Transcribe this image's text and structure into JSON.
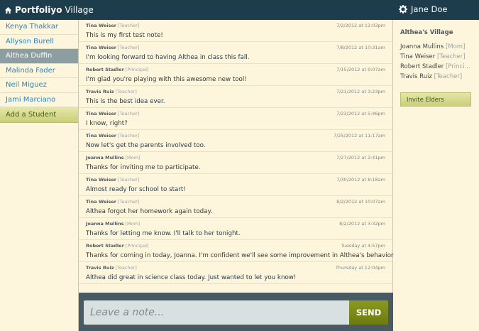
{
  "header": {
    "brand_bold": "Portfoliyo",
    "brand_rest": "Village",
    "user_name": "Jane Doe"
  },
  "students": [
    {
      "name": "Kenya Thakkar",
      "active": false
    },
    {
      "name": "Allyson Burell",
      "active": false
    },
    {
      "name": "Althea Duffin",
      "active": true
    },
    {
      "name": "Malinda Fader",
      "active": false
    },
    {
      "name": "Neil Miguez",
      "active": false
    },
    {
      "name": "Jami Marciano",
      "active": false
    }
  ],
  "add_student_label": "Add a Student",
  "notes": [
    {
      "author": "Tina Weiser",
      "role": "[Teacher]",
      "time": "7/2/2012 at 12:03pm",
      "text": "This is my first test note!"
    },
    {
      "author": "Tina Weiser",
      "role": "[Teacher]",
      "time": "7/8/2012 at 10:31am",
      "text": "I'm looking forward to having Althea in class this fall."
    },
    {
      "author": "Robert Stadler",
      "role": "[Principal]",
      "time": "7/15/2012 at 9:07am",
      "text": "I'm glad you're playing with this awesome new tool!"
    },
    {
      "author": "Travis Ruiz",
      "role": "[Teacher]",
      "time": "7/21/2012 at 3:23pm",
      "text": "This is the best idea ever."
    },
    {
      "author": "Tina Weiser",
      "role": "[Teacher]",
      "time": "7/23/2012 at 5:46pm",
      "text": "I know, right?"
    },
    {
      "author": "Tina Weiser",
      "role": "[Teacher]",
      "time": "7/25/2012 at 11:17am",
      "text": "Now let's get the parents involved too."
    },
    {
      "author": "Joanna Mullins",
      "role": "[Mom]",
      "time": "7/27/2012 at 2:41pm",
      "text": "Thanks for inviting me to participate."
    },
    {
      "author": "Tina Weiser",
      "role": "[Teacher]",
      "time": "7/30/2012 at 8:18am",
      "text": "Almost ready for school to start!"
    },
    {
      "author": "Tina Weiser",
      "role": "[Teacher]",
      "time": "8/2/2012 at 10:07am",
      "text": "Althea forgot her homework again today."
    },
    {
      "author": "Joanna Mullins",
      "role": "[Mom]",
      "time": "8/2/2012 at 3:32pm",
      "text": "Thanks for letting me know. I'll talk to her tonight."
    },
    {
      "author": "Robert Stadler",
      "role": "[Principal]",
      "time": "Tuesday at 4:57pm",
      "text": "Thanks for coming in today, Joanna. I'm confident we'll see some improvement in Althea's behavior!"
    },
    {
      "author": "Travis Ruiz",
      "role": "[Teacher]",
      "time": "Thursday at 12:04pm",
      "text": "Althea did great in science class today. Just wanted to let you know!"
    }
  ],
  "compose": {
    "placeholder": "Leave a note...",
    "value": "",
    "send_label": "SEND"
  },
  "village": {
    "title": "Althea's Village",
    "members": [
      {
        "name": "Joanna Mullins",
        "role": "[Mom]"
      },
      {
        "name": "Tina Weiser",
        "role": "[Teacher]"
      },
      {
        "name": "Robert Stadler",
        "role": "[Princi..."
      },
      {
        "name": "Travis Ruiz",
        "role": "[Teacher]"
      }
    ],
    "invite_label": "Invite Elders"
  },
  "colors": {
    "topbar": "#1d3d4c",
    "background": "#fdf6dc",
    "link": "#2a85c4",
    "active_student": "#8d9ea3",
    "send_button": "#7a8a18"
  }
}
